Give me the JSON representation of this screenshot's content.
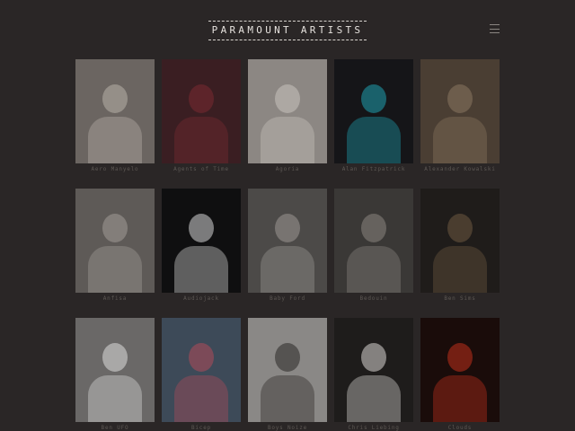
{
  "header": {
    "logo": "PARAMOUNT ARTISTS",
    "menu_icon": "hamburger-menu-icon"
  },
  "artists": [
    {
      "name": "Aero Manyelo",
      "tone": "#6b6561",
      "accent": "#b8b2aa"
    },
    {
      "name": "Agents of Time",
      "tone": "#3a1e22",
      "accent": "#7a2a32"
    },
    {
      "name": "Agoria",
      "tone": "#8c8783",
      "accent": "#c9c3bd"
    },
    {
      "name": "Alan Fitzpatrick",
      "tone": "#151518",
      "accent": "#1fa0b0"
    },
    {
      "name": "Alexander Kowalski",
      "tone": "#4a3e33",
      "accent": "#8a7660"
    },
    {
      "name": "Anfisa",
      "tone": "#5e5a57",
      "accent": "#a29d98"
    },
    {
      "name": "Audiojack",
      "tone": "#0f0f10",
      "accent": "#d6d6d6"
    },
    {
      "name": "Baby Ford",
      "tone": "#4c4a48",
      "accent": "#9c9894"
    },
    {
      "name": "Bedouin",
      "tone": "#3a3836",
      "accent": "#8a8580"
    },
    {
      "name": "Ben Sims",
      "tone": "#1f1c1a",
      "accent": "#6d5a42"
    },
    {
      "name": "Ben UFO",
      "tone": "#6a6867",
      "accent": "#dcdcdc"
    },
    {
      "name": "Bicep",
      "tone": "#3d4a58",
      "accent": "#b04a5a"
    },
    {
      "name": "Boys Noize",
      "tone": "#8a8886",
      "accent": "#2a2826"
    },
    {
      "name": "Chris Liebing",
      "tone": "#1e1c1b",
      "accent": "#d8d6d2"
    },
    {
      "name": "Clouds",
      "tone": "#1a0c0a",
      "accent": "#c0301c"
    }
  ]
}
